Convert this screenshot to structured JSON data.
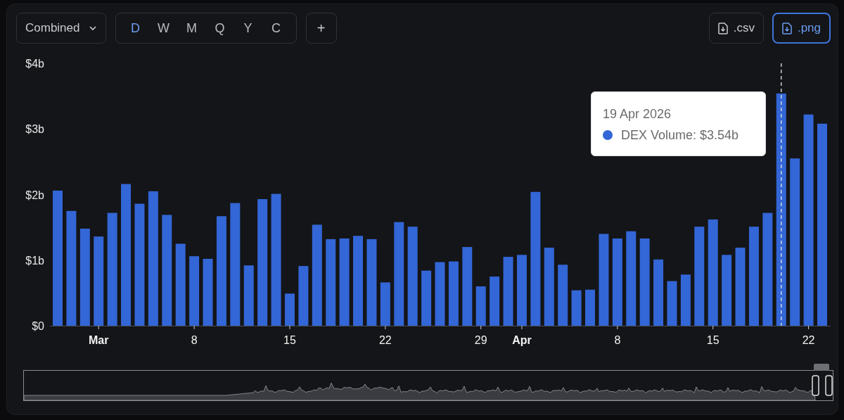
{
  "toolbar": {
    "view_select": {
      "value": "Combined"
    },
    "periods": [
      {
        "label": "D",
        "selected": true
      },
      {
        "label": "W",
        "selected": false
      },
      {
        "label": "M",
        "selected": false
      },
      {
        "label": "Q",
        "selected": false
      },
      {
        "label": "Y",
        "selected": false
      },
      {
        "label": "C",
        "selected": false
      }
    ],
    "add_button": "+",
    "downloads": [
      {
        "label": ".csv",
        "focused": false
      },
      {
        "label": ".png",
        "focused": true
      }
    ]
  },
  "chart": {
    "chart_data": {
      "type": "bar",
      "categories": [
        null,
        null,
        null,
        "Mar",
        null,
        null,
        null,
        null,
        null,
        null,
        "8",
        null,
        null,
        null,
        null,
        null,
        null,
        "15",
        null,
        null,
        null,
        null,
        null,
        null,
        "22",
        null,
        null,
        null,
        null,
        null,
        null,
        "29",
        null,
        null,
        "Apr",
        null,
        null,
        null,
        null,
        null,
        null,
        "8",
        null,
        null,
        null,
        null,
        null,
        null,
        "15",
        null,
        null,
        null,
        null,
        null,
        null,
        "22",
        null
      ],
      "series": [
        {
          "color": "#3366d6",
          "values": [
            2.06,
            1.75,
            1.48,
            1.36,
            1.72,
            2.16,
            1.86,
            2.05,
            1.69,
            1.25,
            1.06,
            1.02,
            1.67,
            1.87,
            0.92,
            1.93,
            2.01,
            0.49,
            0.91,
            1.54,
            1.32,
            1.33,
            1.37,
            1.32,
            0.66,
            1.58,
            1.51,
            0.84,
            0.97,
            0.98,
            1.2,
            0.6,
            0.75,
            1.05,
            1.08,
            2.04,
            1.19,
            0.93,
            0.54,
            0.55,
            1.4,
            1.33,
            1.44,
            1.33,
            1.01,
            0.68,
            0.78,
            1.51,
            1.62,
            1.08,
            1.19,
            1.51,
            1.72,
            3.54,
            2.55,
            3.22,
            3.08
          ]
        }
      ],
      "ylim": [
        0,
        4
      ],
      "yticks": [
        {
          "value": 0,
          "label": "$0"
        },
        {
          "value": 1,
          "label": "$1b"
        },
        {
          "value": 2,
          "label": "$2b"
        },
        {
          "value": 3,
          "label": "$3b"
        },
        {
          "value": 4,
          "label": "$4b"
        }
      ]
    },
    "tooltip": {
      "title": "19 Apr 2026",
      "text": "DEX Volume: $3.54b"
    }
  }
}
